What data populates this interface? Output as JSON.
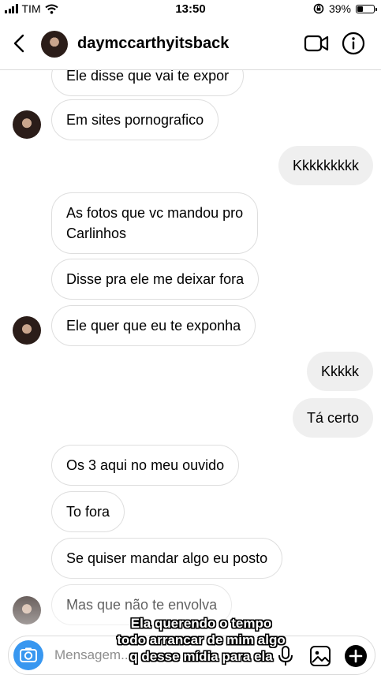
{
  "status_bar": {
    "carrier": "TIM",
    "time": "13:50",
    "battery": "39%",
    "battery_level": 0.39
  },
  "header": {
    "username": "daymccarthyitsback"
  },
  "messages": [
    {
      "text": "Ele disse que vai te expor",
      "direction": "incoming"
    },
    {
      "text": "Em sites pornografico",
      "direction": "incoming"
    },
    {
      "text": "Kkkkkkkkk",
      "direction": "outgoing"
    },
    {
      "text_lines": [
        "As fotos que vc mandou pro",
        "Carlinhos"
      ],
      "direction": "incoming"
    },
    {
      "text": "Disse pra ele me deixar fora",
      "direction": "incoming"
    },
    {
      "text": "Ele quer que eu te exponha",
      "direction": "incoming"
    },
    {
      "text": "Kkkkk",
      "direction": "outgoing"
    },
    {
      "text": "Tá certo",
      "direction": "outgoing"
    },
    {
      "text": "Os 3 aqui no meu ouvido",
      "direction": "incoming"
    },
    {
      "text": "To fora",
      "direction": "incoming"
    },
    {
      "text": "Se quiser mandar algo eu posto",
      "direction": "incoming"
    },
    {
      "text": "Mas que não te envolva",
      "direction": "incoming"
    }
  ],
  "composer": {
    "placeholder": "Mensagem..."
  },
  "caption": {
    "lines": [
      "Ela querendo o tempo",
      "todo arrancar de mim algo",
      "q desse mídia para ela"
    ]
  },
  "colors": {
    "accent": "#3897f0",
    "outgoing_bubble": "#efefef",
    "incoming_border": "#dedede"
  }
}
